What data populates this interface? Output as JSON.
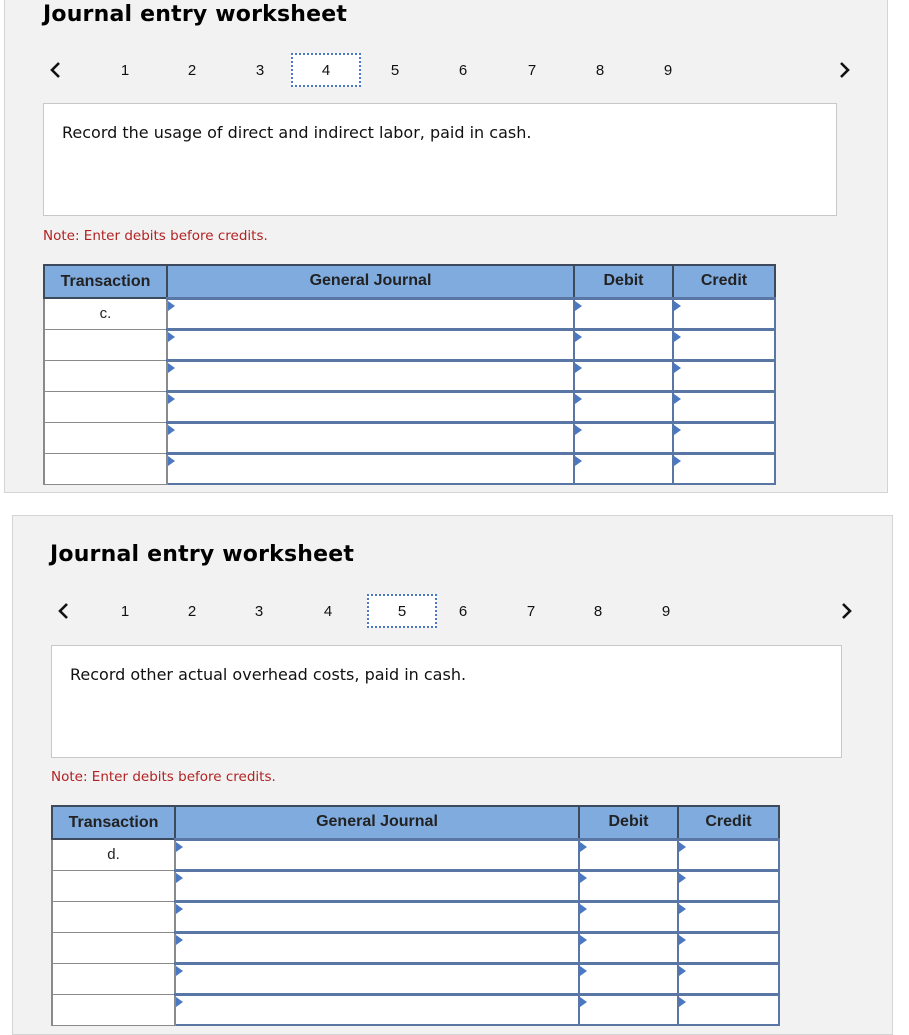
{
  "worksheets": [
    {
      "title": "Journal entry worksheet",
      "pager": {
        "prev_icon": "chevron-left-icon",
        "next_icon": "chevron-right-icon",
        "pages": [
          "1",
          "2",
          "3",
          "4",
          "5",
          "6",
          "7",
          "8",
          "9"
        ],
        "active_page": "4"
      },
      "prompt": "Record the usage of direct and indirect labor, paid in cash.",
      "note": "Note: Enter debits before credits.",
      "table": {
        "headers": [
          "Transaction",
          "General Journal",
          "Debit",
          "Credit"
        ],
        "rows": [
          {
            "transaction": "c.",
            "account": "",
            "debit": "",
            "credit": ""
          },
          {
            "transaction": "",
            "account": "",
            "debit": "",
            "credit": ""
          },
          {
            "transaction": "",
            "account": "",
            "debit": "",
            "credit": ""
          },
          {
            "transaction": "",
            "account": "",
            "debit": "",
            "credit": ""
          },
          {
            "transaction": "",
            "account": "",
            "debit": "",
            "credit": ""
          },
          {
            "transaction": "",
            "account": "",
            "debit": "",
            "credit": ""
          }
        ]
      }
    },
    {
      "title": "Journal entry worksheet",
      "pager": {
        "prev_icon": "chevron-left-icon",
        "next_icon": "chevron-right-icon",
        "pages": [
          "1",
          "2",
          "3",
          "4",
          "5",
          "6",
          "7",
          "8",
          "9"
        ],
        "active_page": "5"
      },
      "prompt": "Record other actual overhead costs, paid in cash.",
      "note": "Note: Enter debits before credits.",
      "table": {
        "headers": [
          "Transaction",
          "General Journal",
          "Debit",
          "Credit"
        ],
        "rows": [
          {
            "transaction": "d.",
            "account": "",
            "debit": "",
            "credit": ""
          },
          {
            "transaction": "",
            "account": "",
            "debit": "",
            "credit": ""
          },
          {
            "transaction": "",
            "account": "",
            "debit": "",
            "credit": ""
          },
          {
            "transaction": "",
            "account": "",
            "debit": "",
            "credit": ""
          },
          {
            "transaction": "",
            "account": "",
            "debit": "",
            "credit": ""
          },
          {
            "transaction": "",
            "account": "",
            "debit": "",
            "credit": ""
          }
        ]
      }
    }
  ],
  "colors": {
    "panel_bg": "#f2f2f2",
    "header_bg": "#7fabdf",
    "input_border": "#5a76a4",
    "active_page_border": "#4a78c2",
    "note_text": "#b22222"
  }
}
